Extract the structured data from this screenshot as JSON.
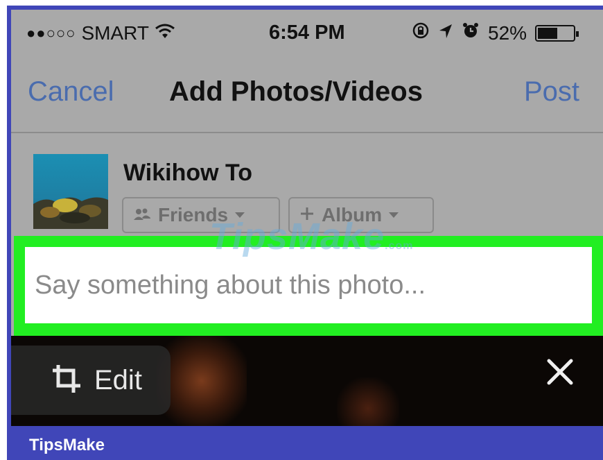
{
  "status_bar": {
    "carrier": "SMART",
    "signal_dots": "●●○○○",
    "time": "6:54 PM",
    "battery_percent": "52%",
    "battery_level": 0.52,
    "icons": [
      "wifi-icon",
      "rotation-lock-icon",
      "location-icon",
      "alarm-icon",
      "battery-icon"
    ]
  },
  "nav": {
    "cancel_label": "Cancel",
    "title": "Add Photos/Videos",
    "post_label": "Post"
  },
  "author": {
    "name": "Wikihow To",
    "audience_label": "Friends",
    "album_label": "Album"
  },
  "caption": {
    "placeholder": "Say something about this photo..."
  },
  "photo": {
    "edit_label": "Edit"
  },
  "footer": {
    "brand": "TipsMake"
  },
  "watermark": {
    "text": "TipsMake",
    "suffix": ".com"
  },
  "colors": {
    "link": "#4a6cae",
    "highlight": "#22ee22",
    "brand": "#4046b8"
  }
}
